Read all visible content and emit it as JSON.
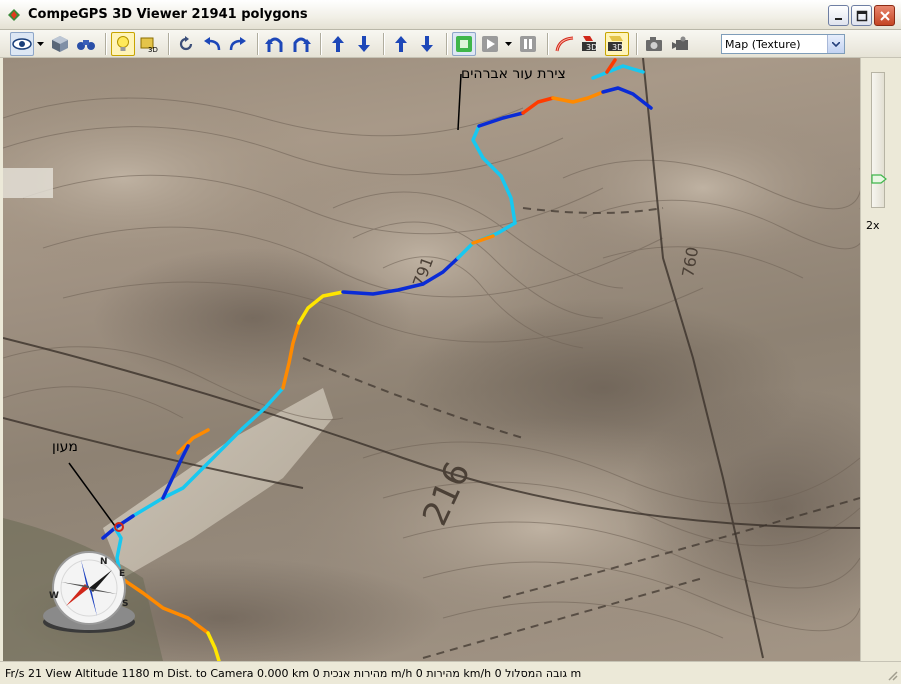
{
  "window": {
    "title": "CompeGPS 3D Viewer  21941 polygons",
    "buttons": [
      "minimize",
      "maximize",
      "close"
    ]
  },
  "toolbar": {
    "icons": [
      "eye-view-icon",
      "cube-icon",
      "binoculars-icon",
      "lightbulb-icon",
      "3d-box-icon",
      "rotate-icon",
      "undo-arrow-icon",
      "redo-arrow-icon",
      "turn-left-icon",
      "turn-right-icon",
      "move-up-icon",
      "move-down-icon",
      "altitude-up-icon",
      "altitude-down-icon",
      "stop-icon",
      "play-icon",
      "pause-icon",
      "track-icon",
      "3d-marker-icon",
      "3d-waypoint-icon",
      "camera-icon",
      "video-camera-icon"
    ],
    "map_select": {
      "value": "Map (Texture)"
    }
  },
  "map": {
    "labels": {
      "top_point": "צירת עור אברהים",
      "start_point": "מעון"
    },
    "compass": {
      "letters": [
        "N",
        "E",
        "S",
        "W"
      ]
    }
  },
  "zoom": {
    "label": "2x",
    "level_fraction": 0.25
  },
  "status": {
    "text": "Fr/s 21 View Altitude 1180 m Dist. to Camera 0.000 km 0 מהירות אנכית m/h 0 מהירות km/h 0 גובה המסלול m"
  },
  "colors": {
    "track_fast": "#ff3b00",
    "track_mid": "#ffe600",
    "track_slow": "#0a2bd6",
    "track_cyan": "#18c8f0",
    "accent_green": "#3fb64a"
  }
}
